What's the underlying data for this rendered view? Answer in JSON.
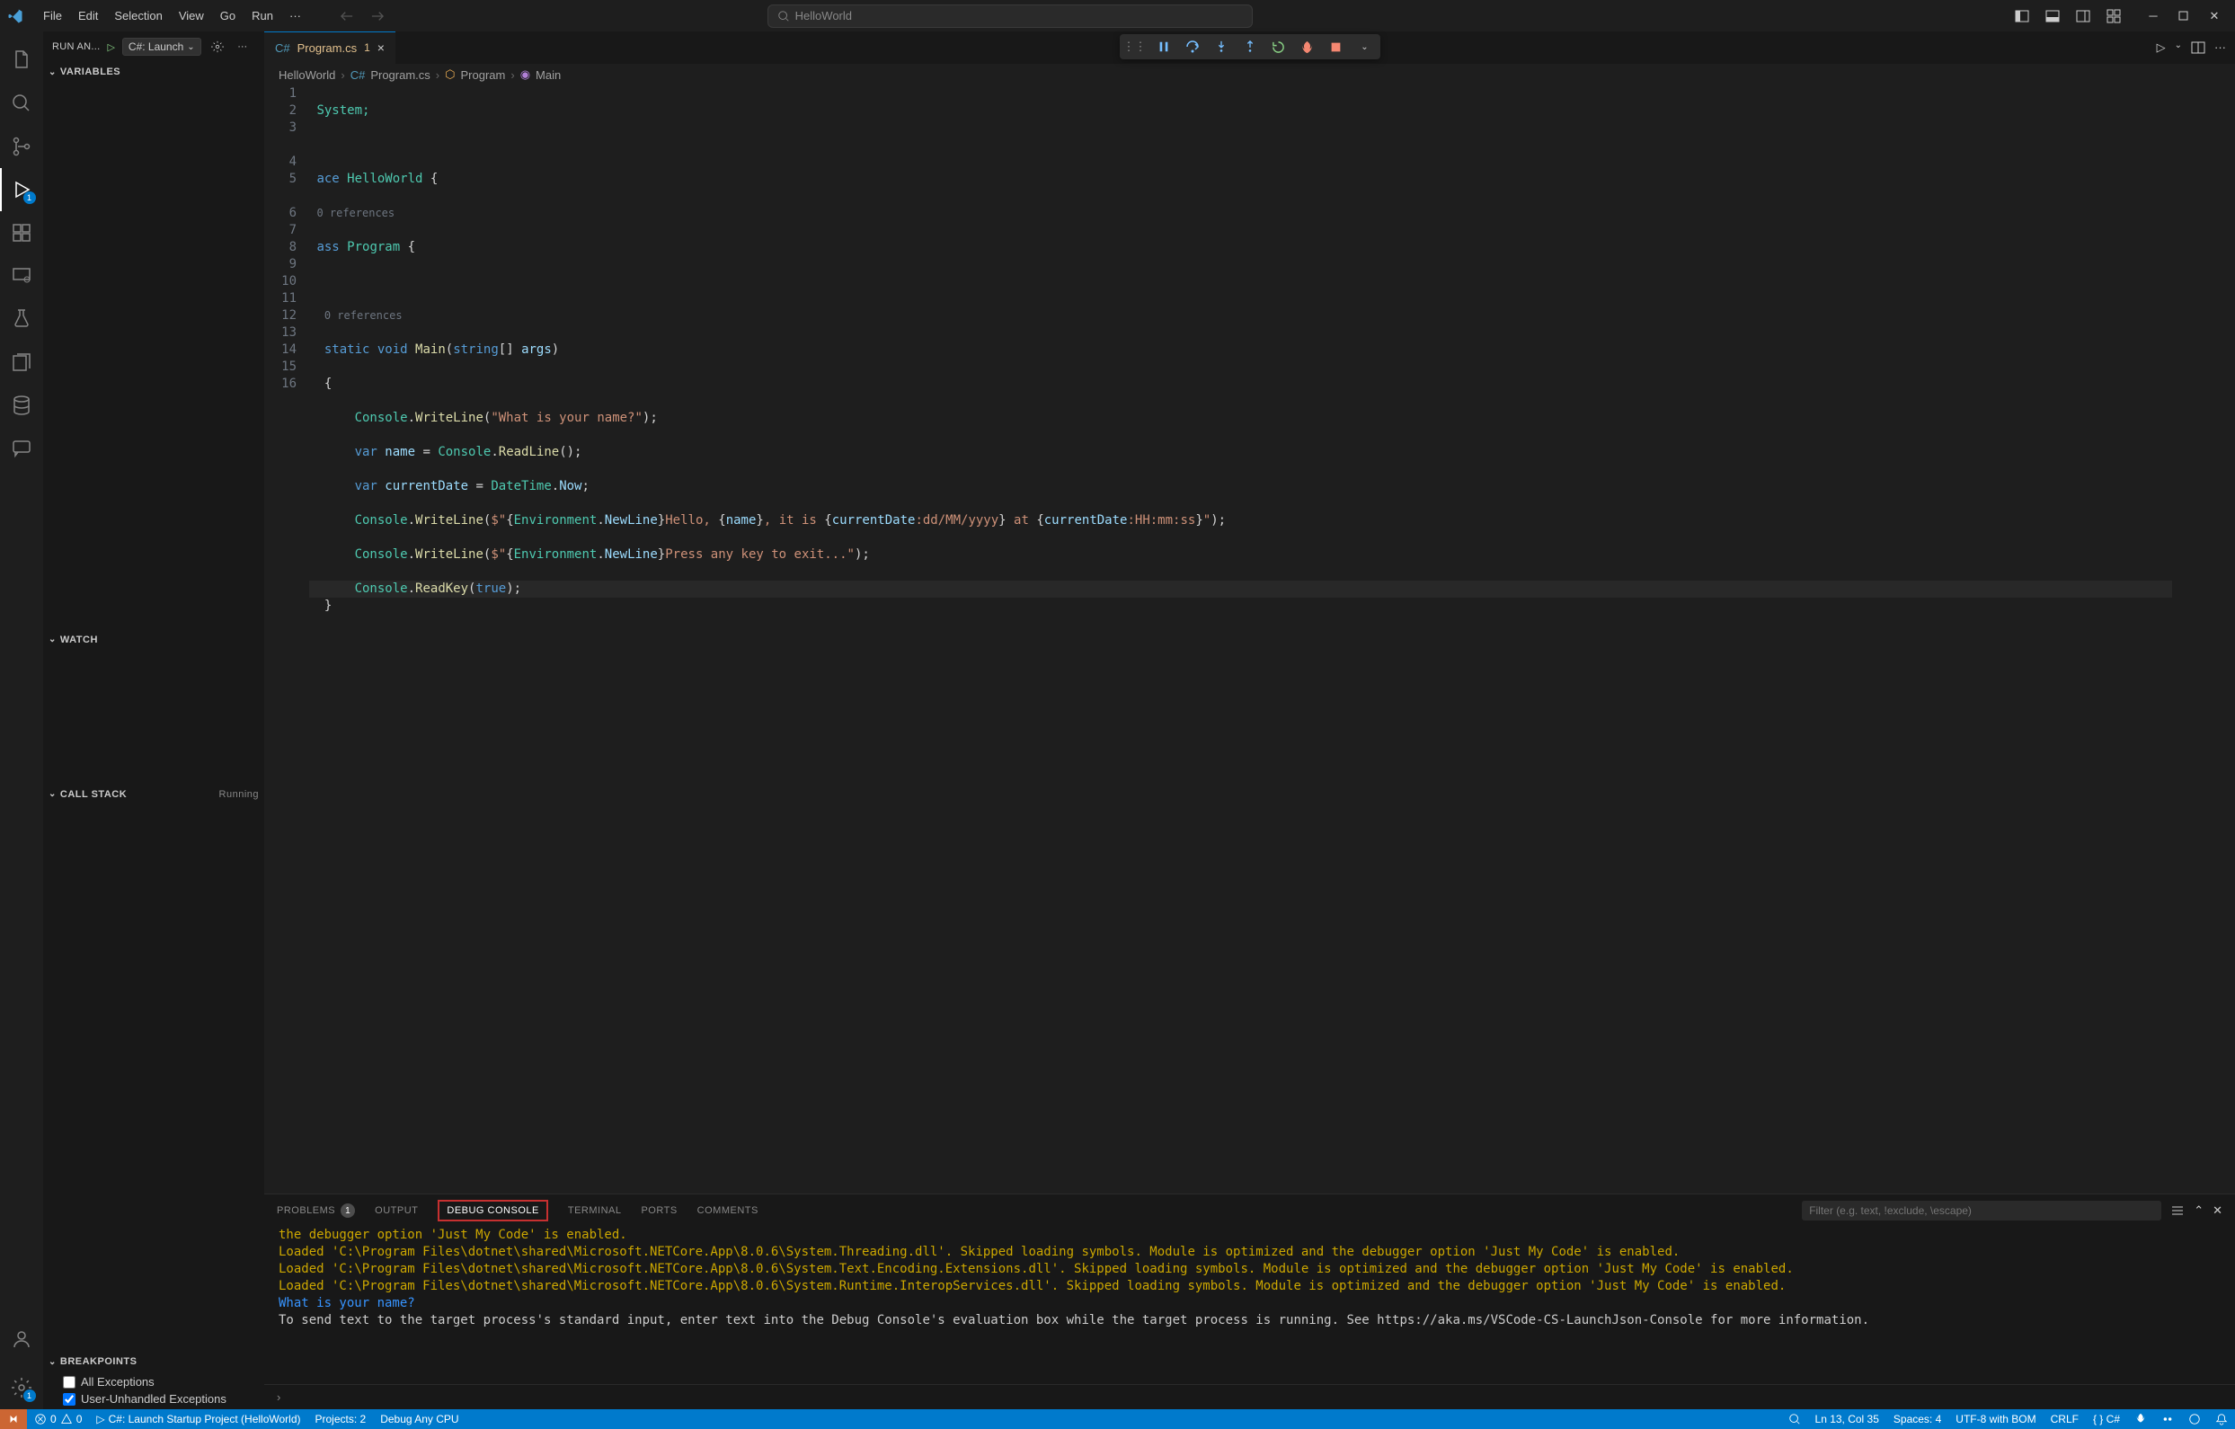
{
  "titlebar": {
    "menu": [
      "File",
      "Edit",
      "Selection",
      "View",
      "Go",
      "Run",
      "···"
    ],
    "search": "HelloWorld"
  },
  "activitybar": {
    "debug_badge": "1",
    "settings_badge": "1"
  },
  "sidebar": {
    "title": "RUN AN...",
    "config": "C#: Launch",
    "sections": {
      "variables": "VARIABLES",
      "watch": "WATCH",
      "callstack": "CALL STACK",
      "callstack_status": "Running",
      "breakpoints": "BREAKPOINTS"
    },
    "breakpoints": [
      {
        "label": "All Exceptions",
        "checked": false
      },
      {
        "label": "User-Unhandled Exceptions",
        "checked": true
      }
    ]
  },
  "tabs": [
    {
      "name": "Program.cs",
      "modified": "1"
    }
  ],
  "breadcrumb": [
    "HelloWorld",
    "Program.cs",
    "Program",
    "Main"
  ],
  "editor": {
    "lines": [
      "1",
      "2",
      "3",
      "4",
      "5",
      "",
      "6",
      "7",
      "8",
      "9",
      "10",
      "11",
      "12",
      "13",
      "14",
      "15",
      "16"
    ],
    "ref0": "0 references",
    "ref1": "0 references",
    "code": {
      "l1": "System;",
      "l3_ns": "ace ",
      "l3_cls": "HelloWorld",
      "l3_brace": " {",
      "l4_kw": "ass ",
      "l4_cls": "Program",
      "l4_brace": " {",
      "l6_a": "static ",
      "l6_b": "void ",
      "l6_fn": "Main",
      "l6_p": "(",
      "l6_str": "string",
      "l6_arr": "[] ",
      "l6_args": "args",
      "l6_cp": ")",
      "l7": "{",
      "l8_a": "Console",
      "l8_dot": ".",
      "l8_fn": "WriteLine",
      "l8_p": "(",
      "l8_s": "\"What is your name?\"",
      "l8_e": ");",
      "l9_a": "var ",
      "l9_v": "name",
      "l9_eq": " = ",
      "l9_c": "Console",
      "l9_d": ".",
      "l9_fn": "ReadLine",
      "l9_e": "();",
      "l10_a": "var ",
      "l10_v": "currentDate",
      "l10_eq": " = ",
      "l10_c": "DateTime",
      "l10_d": ".",
      "l10_p": "Now",
      "l10_e": ";",
      "l11_a": "Console",
      "l11_d": ".",
      "l11_fn": "WriteLine",
      "l11_p": "(",
      "l11_s1": "$\"",
      "l11_b1": "{",
      "l11_c1": "Environment",
      "l11_d1": ".",
      "l11_p1": "NewLine",
      "l11_b2": "}",
      "l11_s2": "Hello, ",
      "l11_b3": "{",
      "l11_v1": "name",
      "l11_b4": "}",
      "l11_s3": ", it is ",
      "l11_b5": "{",
      "l11_v2": "currentDate",
      "l11_f1": ":dd/MM/yyyy",
      "l11_b6": "}",
      "l11_s4": " at ",
      "l11_b7": "{",
      "l11_v3": "currentDate",
      "l11_f2": ":HH:mm:ss",
      "l11_b8": "}",
      "l11_s5": "\"",
      "l11_e": ");",
      "l12_a": "Console",
      "l12_d": ".",
      "l12_fn": "WriteLine",
      "l12_p": "(",
      "l12_s1": "$\"",
      "l12_b1": "{",
      "l12_c1": "Environment",
      "l12_d1": ".",
      "l12_p1": "NewLine",
      "l12_b2": "}",
      "l12_s2": "Press any key to exit...\"",
      "l12_e": ");",
      "l13_a": "Console",
      "l13_d": ".",
      "l13_fn": "ReadKey",
      "l13_p": "(",
      "l13_t": "true",
      "l13_e": ");",
      "l14": "}"
    }
  },
  "panel": {
    "tabs": {
      "problems": "PROBLEMS",
      "problems_badge": "1",
      "output": "OUTPUT",
      "debug": "DEBUG CONSOLE",
      "terminal": "TERMINAL",
      "ports": "PORTS",
      "comments": "COMMENTS"
    },
    "filter_placeholder": "Filter (e.g. text, !exclude, \\escape)",
    "lines": [
      {
        "cls": "warn",
        "text": "the debugger option 'Just My Code' is enabled."
      },
      {
        "cls": "warn",
        "text": "Loaded 'C:\\Program Files\\dotnet\\shared\\Microsoft.NETCore.App\\8.0.6\\System.Threading.dll'. Skipped loading symbols. Module is optimized and the debugger option 'Just My Code' is enabled."
      },
      {
        "cls": "warn",
        "text": "Loaded 'C:\\Program Files\\dotnet\\shared\\Microsoft.NETCore.App\\8.0.6\\System.Text.Encoding.Extensions.dll'. Skipped loading symbols. Module is optimized and the debugger option 'Just My Code' is enabled."
      },
      {
        "cls": "warn",
        "text": "Loaded 'C:\\Program Files\\dotnet\\shared\\Microsoft.NETCore.App\\8.0.6\\System.Runtime.InteropServices.dll'. Skipped loading symbols. Module is optimized and the debugger option 'Just My Code' is enabled."
      },
      {
        "cls": "info",
        "text": "What is your name?"
      },
      {
        "cls": "plain",
        "text": "To send text to the target process's standard input, enter text into the Debug Console's evaluation box while the target process is running. See https://aka.ms/VSCode-CS-LaunchJson-Console for more information."
      }
    ]
  },
  "statusbar": {
    "errors": "0",
    "warnings": "0",
    "launch": "C#: Launch Startup Project (HelloWorld)",
    "projects": "Projects: 2",
    "debug": "Debug Any CPU",
    "ln": "Ln 13, Col 35",
    "spaces": "Spaces: 4",
    "encoding": "UTF-8 with BOM",
    "eol": "CRLF",
    "lang": "{ } C#"
  }
}
